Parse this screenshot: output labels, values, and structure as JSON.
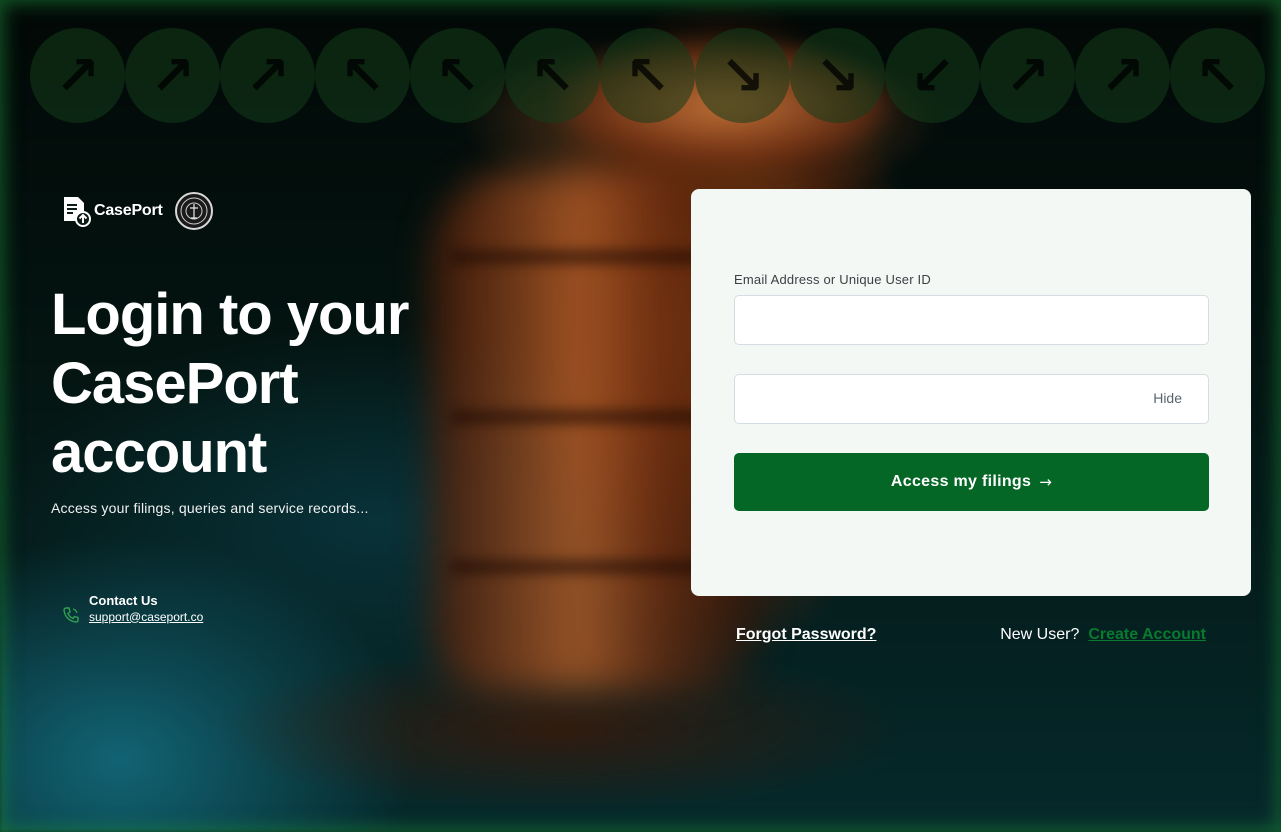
{
  "brand": {
    "name": "CasePort",
    "logo_icon": "document-upload-icon",
    "seal_icon": "court-seal-icon"
  },
  "decor": {
    "arrows": [
      "↗",
      "↗",
      "↗",
      "↖",
      "↖",
      "↖",
      "↖",
      "↘",
      "↘",
      "↙",
      "↗",
      "↗",
      "↖"
    ]
  },
  "hero": {
    "headline": "Login to your CasePort account",
    "subhead": "Access your filings, queries and service records..."
  },
  "contact": {
    "icon": "phone-icon",
    "title": "Contact Us",
    "email": "support@caseport.co"
  },
  "form": {
    "email_label": "Email Address or Unique User ID",
    "email_value": "",
    "password_value": "",
    "password_toggle": "Hide",
    "submit_label": "Access my filings",
    "submit_icon": "→"
  },
  "footer_links": {
    "forgot": "Forgot Password?",
    "new_user": "New User?",
    "create": "Create Account"
  },
  "colors": {
    "primary": "#046726",
    "link_green": "#077a2f",
    "card_bg": "#f4f8f5"
  }
}
